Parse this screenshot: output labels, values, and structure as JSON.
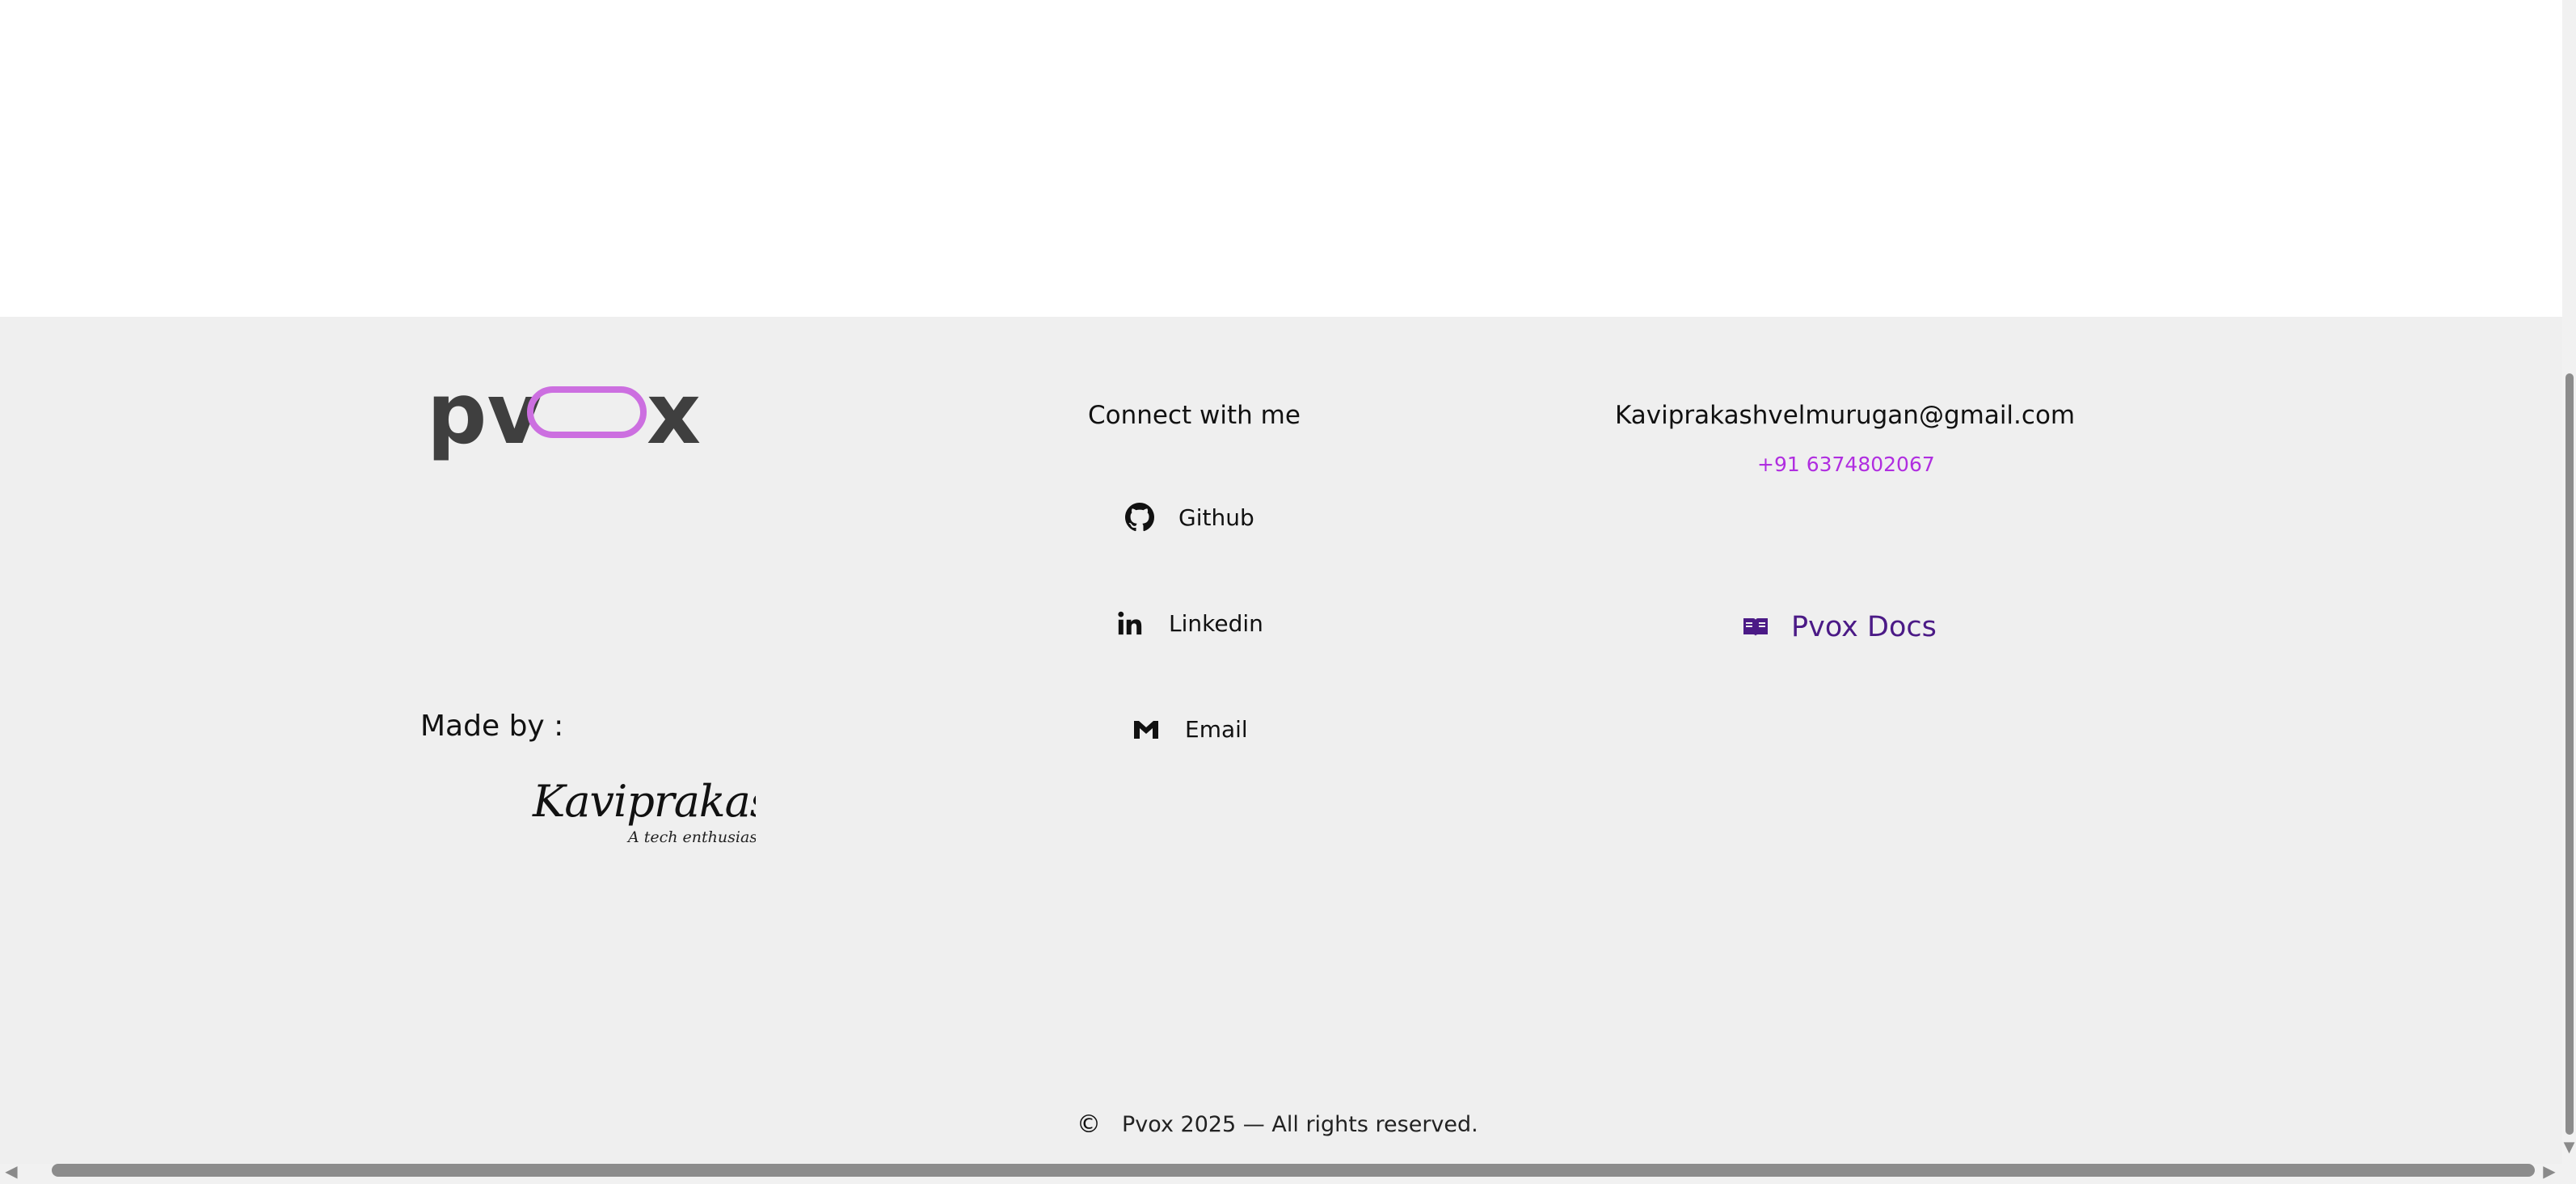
{
  "logo": {
    "text_left": "pv",
    "text_right": "x",
    "accent": "#cc6fe0",
    "text_color": "#3f3f3f"
  },
  "made_by": {
    "label": "Made by :",
    "signature_name": "Kaviprakash V",
    "signature_tagline": "A tech enthusiast"
  },
  "connect": {
    "title": "Connect with me",
    "links": [
      {
        "label": "Github",
        "icon": "github-icon"
      },
      {
        "label": "Linkedin",
        "icon": "linkedin-icon"
      },
      {
        "label": "Email",
        "icon": "gmail-icon"
      }
    ]
  },
  "contact": {
    "email": "Kaviprakashvelmurugan@gmail.com",
    "phone": "+91 6374802067",
    "phone_color": "#b02ee0",
    "docs_label": "Pvox Docs",
    "docs_icon": "book-icon",
    "docs_color": "#4b1a86"
  },
  "copyright": {
    "symbol": "©",
    "text": "Pvox 2025 — All rights reserved."
  },
  "colors": {
    "footer_bg": "#efefef",
    "page_bg": "#ffffff"
  }
}
